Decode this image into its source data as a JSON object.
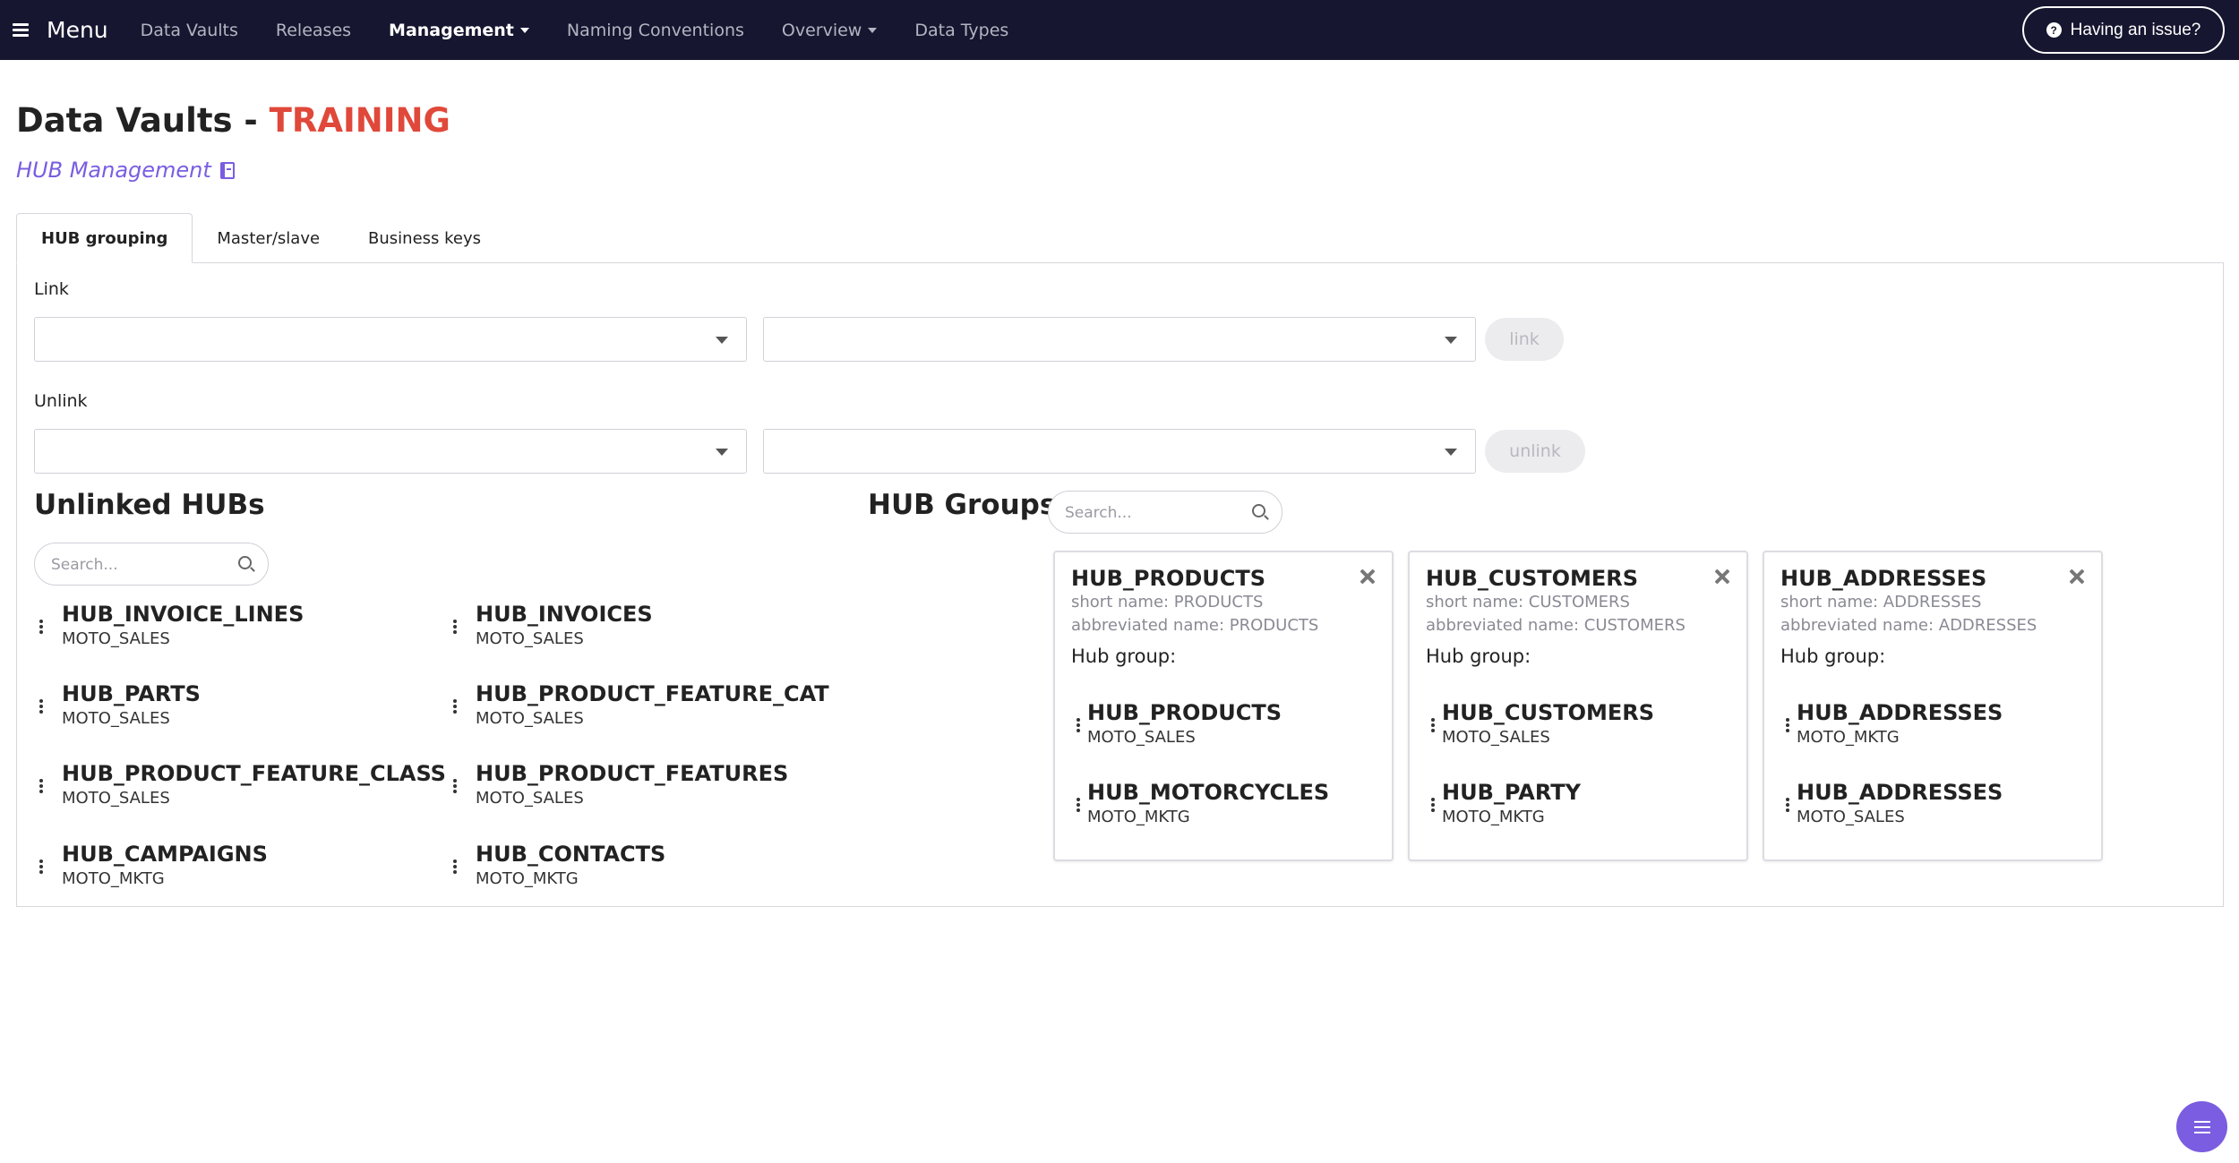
{
  "nav": {
    "menu_label": "Menu",
    "links": [
      {
        "label": "Data Vaults",
        "active": false,
        "dropdown": false
      },
      {
        "label": "Releases",
        "active": false,
        "dropdown": false
      },
      {
        "label": "Management",
        "active": true,
        "dropdown": true
      },
      {
        "label": "Naming Conventions",
        "active": false,
        "dropdown": false
      },
      {
        "label": "Overview",
        "active": false,
        "dropdown": true
      },
      {
        "label": "Data Types",
        "active": false,
        "dropdown": false
      }
    ],
    "issue_button": "Having an issue?",
    "issue_icon": "question-circle-icon"
  },
  "header": {
    "title": "Data Vaults -",
    "environment": "TRAINING",
    "subtitle": "HUB Management",
    "subtitle_icon": "book-icon"
  },
  "tabs": [
    {
      "label": "HUB grouping",
      "active": true
    },
    {
      "label": "Master/slave",
      "active": false
    },
    {
      "label": "Business keys",
      "active": false
    }
  ],
  "link_section": {
    "label": "Link",
    "left_value": "",
    "right_value": "",
    "button": "link"
  },
  "unlink_section": {
    "label": "Unlink",
    "left_value": "",
    "right_value": "",
    "button": "unlink"
  },
  "unlinked": {
    "title": "Unlinked HUBs",
    "search_placeholder": "Search...",
    "items": [
      {
        "name": "HUB_INVOICE_LINES",
        "source": "MOTO_SALES"
      },
      {
        "name": "HUB_INVOICES",
        "source": "MOTO_SALES"
      },
      {
        "name": "HUB_PARTS",
        "source": "MOTO_SALES"
      },
      {
        "name": "HUB_PRODUCT_FEATURE_CAT",
        "source": "MOTO_SALES"
      },
      {
        "name": "HUB_PRODUCT_FEATURE_CLASS",
        "source": "MOTO_SALES"
      },
      {
        "name": "HUB_PRODUCT_FEATURES",
        "source": "MOTO_SALES"
      },
      {
        "name": "HUB_CAMPAIGNS",
        "source": "MOTO_MKTG"
      },
      {
        "name": "HUB_CONTACTS",
        "source": "MOTO_MKTG"
      }
    ]
  },
  "groups": {
    "title": "HUB Groups",
    "search_placeholder": "Search...",
    "cards": [
      {
        "title": "HUB_PRODUCTS",
        "short_name": "short name: PRODUCTS",
        "abbreviated_name": "abbreviated name: PRODUCTS",
        "group_label": "Hub group:",
        "members": [
          {
            "name": "HUB_PRODUCTS",
            "source": "MOTO_SALES"
          },
          {
            "name": "HUB_MOTORCYCLES",
            "source": "MOTO_MKTG"
          }
        ]
      },
      {
        "title": "HUB_CUSTOMERS",
        "short_name": "short name: CUSTOMERS",
        "abbreviated_name": "abbreviated name: CUSTOMERS",
        "group_label": "Hub group:",
        "members": [
          {
            "name": "HUB_CUSTOMERS",
            "source": "MOTO_SALES"
          },
          {
            "name": "HUB_PARTY",
            "source": "MOTO_MKTG"
          }
        ]
      },
      {
        "title": "HUB_ADDRESSES",
        "short_name": "short name: ADDRESSES",
        "abbreviated_name": "abbreviated name: ADDRESSES",
        "group_label": "Hub group:",
        "members": [
          {
            "name": "HUB_ADDRESSES",
            "source": "MOTO_MKTG"
          },
          {
            "name": "HUB_ADDRESSES",
            "source": "MOTO_SALES"
          }
        ]
      }
    ]
  },
  "fab": {
    "icon": "list-icon"
  },
  "colors": {
    "navbar_bg": "#161630",
    "environment": "#e0483a",
    "accent": "#7a5de0"
  }
}
